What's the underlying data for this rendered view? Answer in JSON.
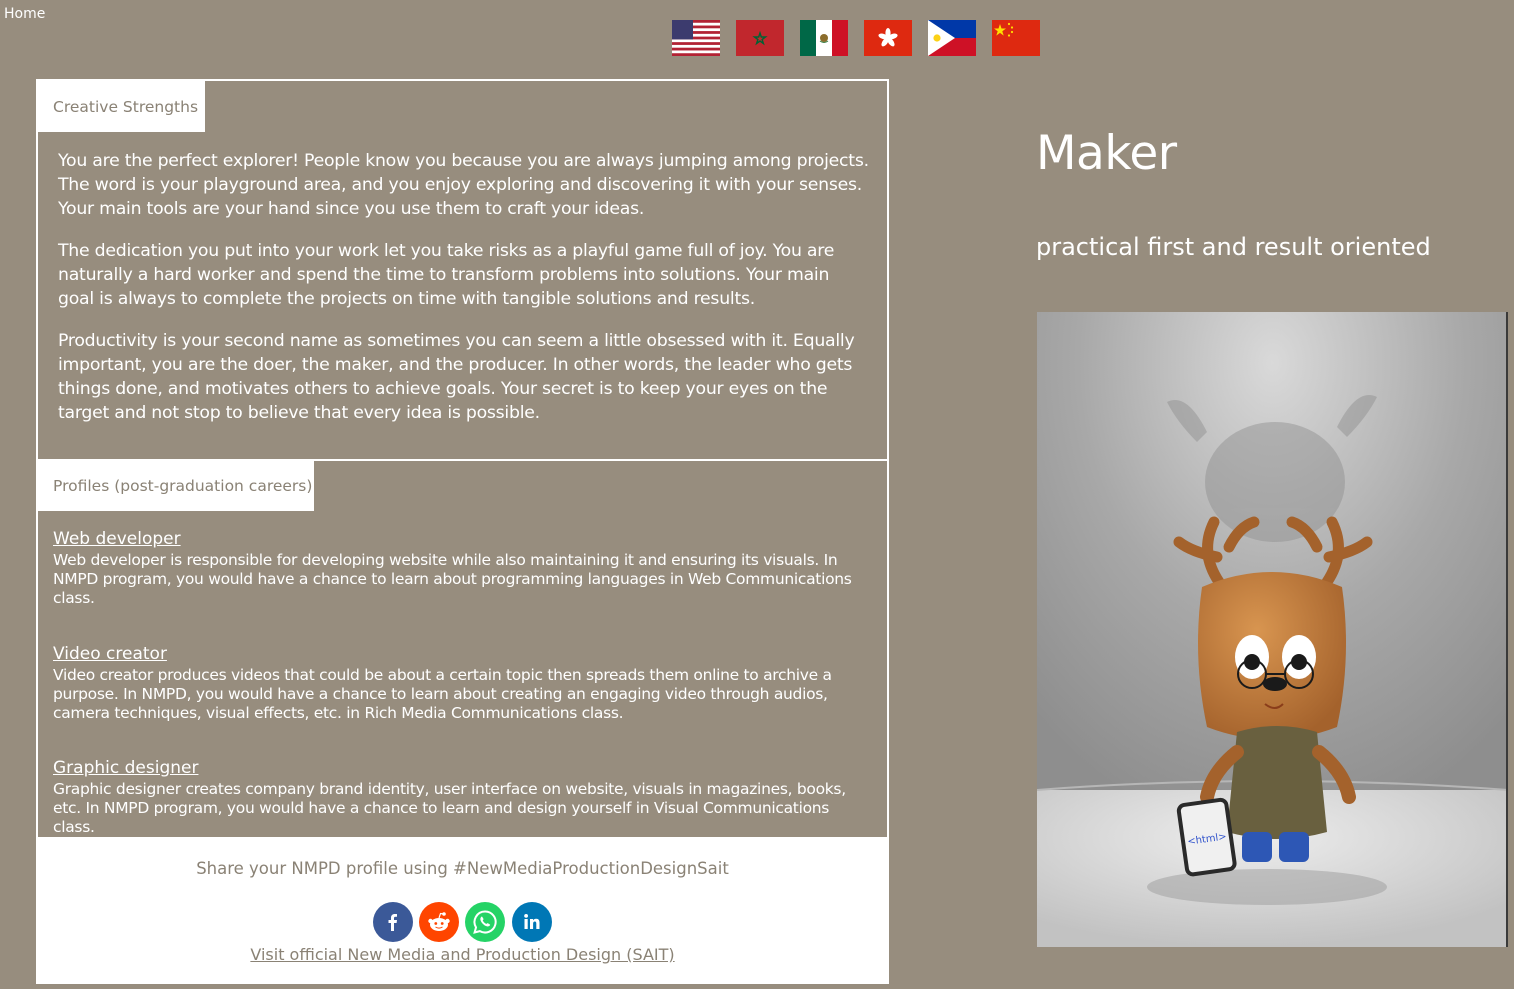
{
  "nav": {
    "home_label": "Home"
  },
  "flags": [
    {
      "name": "usa-flag-icon",
      "country": "United States"
    },
    {
      "name": "morocco-flag-icon",
      "country": "Morocco"
    },
    {
      "name": "mexico-flag-icon",
      "country": "Mexico"
    },
    {
      "name": "hong-kong-flag-icon",
      "country": "Hong Kong"
    },
    {
      "name": "philippines-flag-icon",
      "country": "Philippines"
    },
    {
      "name": "china-flag-icon",
      "country": "China"
    }
  ],
  "strengths": {
    "tab_label": "Creative Strengths",
    "paragraphs": [
      "You are the perfect explorer! People know you because you are always jumping among projects. The word is your playground area, and you enjoy exploring and discovering it with your senses. Your main tools are your hand since you use them to craft your ideas.",
      "The dedication you put into your work let you take risks as a playful game full of joy. You are naturally a hard worker and spend the time to transform problems into solutions. Your main goal is always to complete the projects on time with tangible solutions and results.",
      "Productivity is your second name as sometimes you can seem a little obsessed with it. Equally important, you are the doer, the maker, and the producer. In other words, the leader who gets things done, and motivates others to achieve goals. Your secret is to keep your eyes on the target and not stop to believe that every idea is possible."
    ]
  },
  "profiles": {
    "tab_label": "Profiles (post-graduation careers)",
    "items": [
      {
        "title": "Web developer",
        "description": "Web developer is responsible for developing website while also maintaining it and ensuring its visuals. In NMPD program, you would have a chance to learn about programming languages in Web Communications class."
      },
      {
        "title": "Video creator",
        "description": "Video creator produces videos that could be about a certain topic then spreads them online to archive a purpose. In NMPD, you would have a chance to learn about creating an engaging video through audios, camera techniques, visual effects, etc. in Rich Media Communications class."
      },
      {
        "title": "Graphic designer",
        "description": "Graphic designer creates company brand identity, user interface on website, visuals in magazines, books, etc. In NMPD program, you would have a chance to learn and design yourself in Visual Communications class."
      }
    ]
  },
  "share": {
    "text": "Share your NMPD profile using #NewMediaProductionDesignSait",
    "buttons": [
      {
        "name": "facebook-share-icon",
        "color": "#3b5998"
      },
      {
        "name": "reddit-share-icon",
        "color": "#ff4500"
      },
      {
        "name": "whatsapp-share-icon",
        "color": "#25d366"
      },
      {
        "name": "linkedin-share-icon",
        "color": "#0077b5"
      }
    ],
    "visit_link": "Visit official New Media and Production Design (SAIT)"
  },
  "profile_type": {
    "title": "Maker",
    "subtitle": "practical first and result oriented",
    "image_icon": "deer-mascot-with-html-tablet",
    "tablet_text": "<html>"
  },
  "colors": {
    "background": "#978d7e",
    "panel_border": "#ffffff",
    "tab_text": "#8a8275"
  }
}
